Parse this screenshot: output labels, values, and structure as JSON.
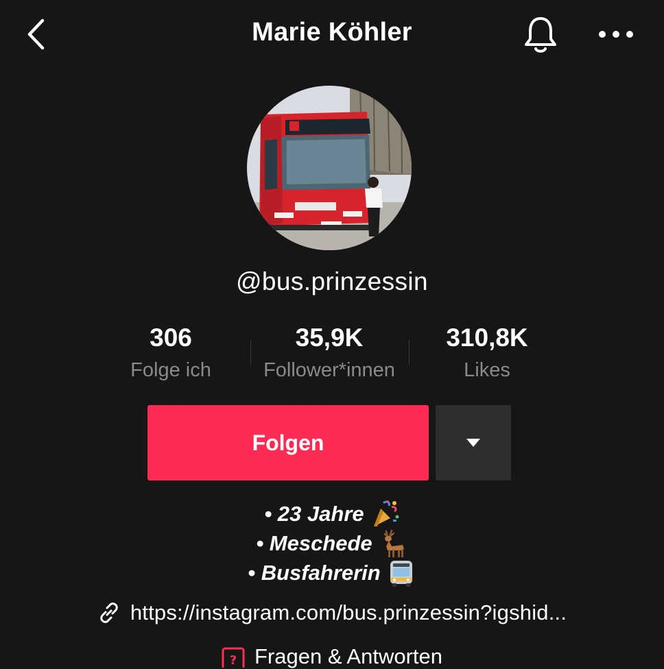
{
  "header": {
    "title": "Marie Köhler",
    "back_icon": "chevron-left-icon",
    "bell_icon": "bell-icon",
    "more_icon": "more-horizontal-icon"
  },
  "profile": {
    "handle": "@bus.prinzessin",
    "stats": [
      {
        "value": "306",
        "label": "Folge ich"
      },
      {
        "value": "35,9K",
        "label": "Follower*innen"
      },
      {
        "value": "310,8K",
        "label": "Likes"
      }
    ],
    "follow_label": "Folgen",
    "dropdown_icon": "caret-down-icon",
    "bio": [
      {
        "text": "• 23 Jahre",
        "emoji": "party-popper-icon"
      },
      {
        "text": "• Meschede",
        "emoji": "deer-icon"
      },
      {
        "text": "• Busfahrerin",
        "emoji": "bus-icon"
      }
    ],
    "link": "https://instagram.com/bus.prinzessin?igshid...",
    "qa_label": "Fragen & Antworten"
  },
  "colors": {
    "background": "#161616",
    "accent": "#fe2c55",
    "secondary_button": "#2e2e2e",
    "muted_text": "#8a8a8a"
  }
}
